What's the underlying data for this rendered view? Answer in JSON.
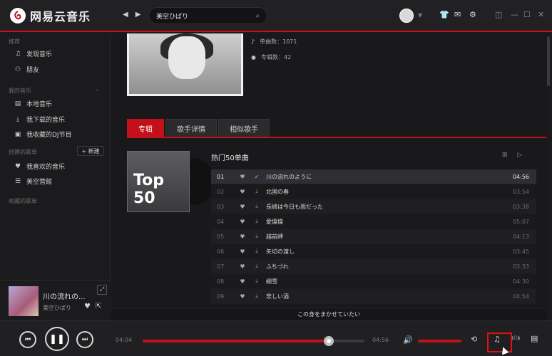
{
  "app": {
    "name": "网易云音乐",
    "search_value": "美空ひばり",
    "top_icons": [
      "shirt-icon",
      "mail-icon",
      "gear-icon",
      "mini-mode-icon",
      "minimize-icon",
      "maximize-icon"
    ]
  },
  "sidebar": {
    "section_recommend": "推荐",
    "recommend_items": [
      {
        "icon": "music-note-icon",
        "label": "发现音乐"
      },
      {
        "icon": "friends-icon",
        "label": "朋友"
      }
    ],
    "section_my_music": "我的音乐",
    "my_music_items": [
      {
        "icon": "local-music-icon",
        "label": "本地音乐"
      },
      {
        "icon": "download-icon",
        "label": "我下载的音乐"
      },
      {
        "icon": "radio-icon",
        "label": "我收藏的DJ节目"
      }
    ],
    "section_created": "创建的歌单",
    "new_button": "+ 新建",
    "created_items": [
      {
        "icon": "heart-icon",
        "label": "我喜欢的音乐"
      },
      {
        "icon": "playlist-icon",
        "label": "美空营館"
      }
    ],
    "section_collected": "收藏的歌单"
  },
  "now_playing": {
    "title": "川の流れの...",
    "artist": "美空ひばり"
  },
  "artist": {
    "single_count": "单曲数：1071",
    "album_count": "专辑数：42"
  },
  "tabs": [
    "专辑",
    "歌手详情",
    "相似歌手"
  ],
  "hot": {
    "title": "热门50单曲",
    "album_label": "Top 50"
  },
  "tracks": [
    {
      "num": "01",
      "title": "川の流れのように",
      "duration": "04:56",
      "playing": true
    },
    {
      "num": "02",
      "title": "北国の春",
      "duration": "03:54"
    },
    {
      "num": "03",
      "title": "長崎は今日も雨だった",
      "duration": "03:38"
    },
    {
      "num": "04",
      "title": "愛燦燦",
      "duration": "05:07"
    },
    {
      "num": "05",
      "title": "越前岬",
      "duration": "04:13"
    },
    {
      "num": "06",
      "title": "矢切の渡し",
      "duration": "03:45"
    },
    {
      "num": "07",
      "title": "ふちづれ",
      "duration": "03:33"
    },
    {
      "num": "08",
      "title": "細雪",
      "duration": "04:30"
    },
    {
      "num": "09",
      "title": "悲しい酒",
      "duration": "04:54"
    }
  ],
  "lyric": "この身をまかせていたい",
  "player": {
    "current_time": "04:04",
    "total_time": "04:56",
    "progress": 0.84,
    "volume": 1.0
  }
}
